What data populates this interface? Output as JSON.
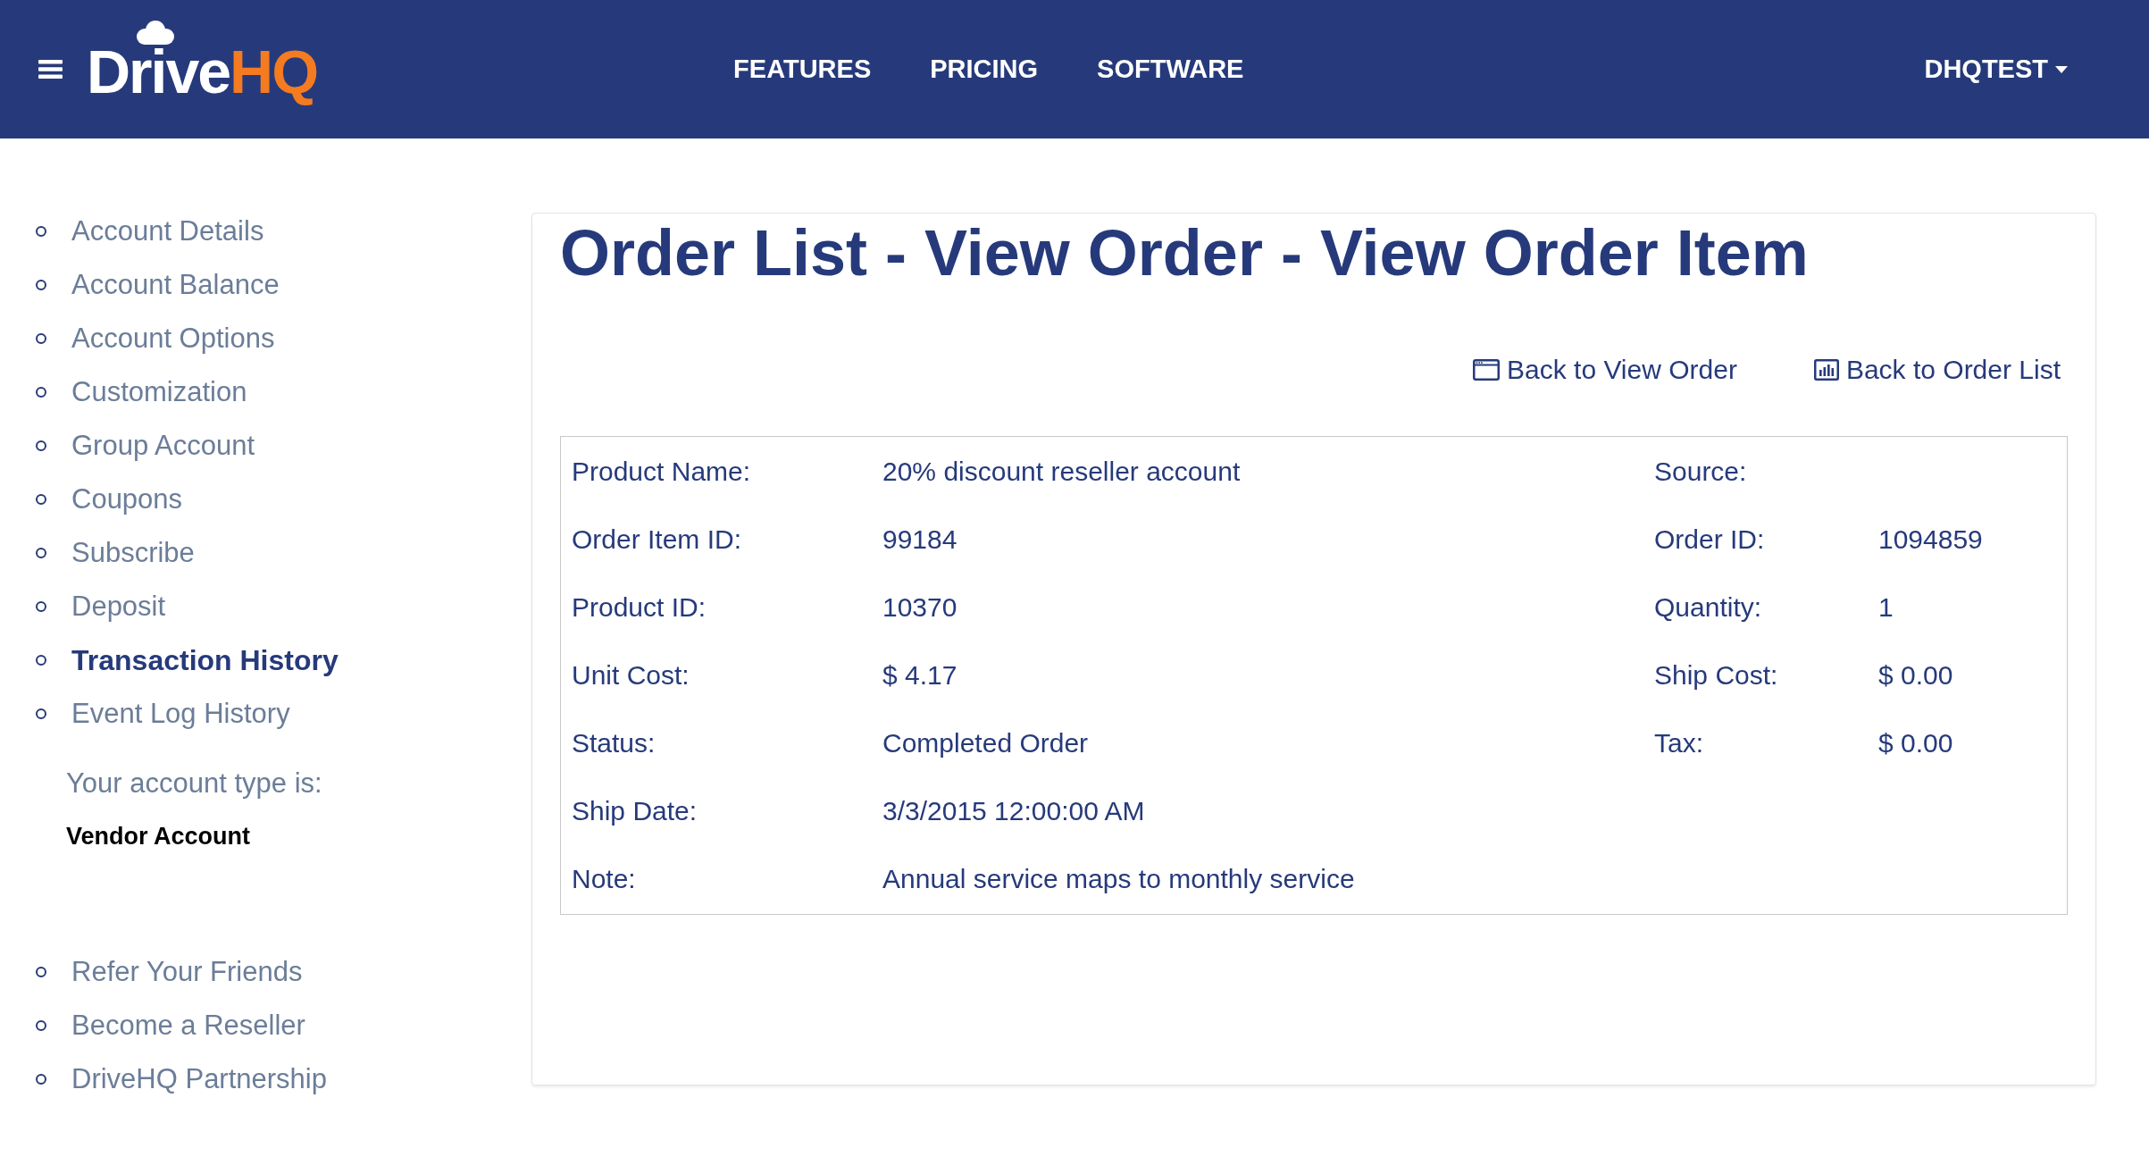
{
  "header": {
    "logo": {
      "text": "Drive",
      "accent": "HQ"
    },
    "nav": [
      {
        "label": "FEATURES"
      },
      {
        "label": "PRICING"
      },
      {
        "label": "SOFTWARE"
      }
    ],
    "user_menu": {
      "label": "DHQTEST"
    }
  },
  "sidebar": {
    "items": [
      {
        "label": "Account Details",
        "selected": false
      },
      {
        "label": "Account Balance",
        "selected": false
      },
      {
        "label": "Account Options",
        "selected": false
      },
      {
        "label": "Customization",
        "selected": false
      },
      {
        "label": "Group Account",
        "selected": false
      },
      {
        "label": "Coupons",
        "selected": false
      },
      {
        "label": "Subscribe",
        "selected": false
      },
      {
        "label": "Deposit",
        "selected": false
      },
      {
        "label": "Transaction History",
        "selected": true
      },
      {
        "label": "Event Log History",
        "selected": false
      }
    ],
    "account_type": {
      "label": "Your account type is:",
      "value": "Vendor Account"
    },
    "more_items": [
      {
        "label": "Refer Your Friends",
        "selected": false
      },
      {
        "label": "Become a Reseller",
        "selected": false
      },
      {
        "label": "DriveHQ Partnership",
        "selected": false
      }
    ]
  },
  "main": {
    "title": "Order List - View Order - View Order Item",
    "links": [
      {
        "label": "Back to View Order"
      },
      {
        "label": "Back to Order List"
      }
    ],
    "details": {
      "rows": [
        {
          "cells": [
            {
              "label": "Product Name:",
              "value": "20% discount reseller account"
            },
            {
              "label": "Source:"
            }
          ]
        },
        {
          "cells": [
            {
              "label": "Order Item ID:",
              "value": "99184"
            },
            {
              "label": "Order ID:",
              "value": "1094859"
            }
          ]
        },
        {
          "cells": [
            {
              "label": "Product ID:",
              "value": "10370"
            },
            {
              "label": "Quantity:",
              "value": "1"
            }
          ]
        },
        {
          "cells": [
            {
              "label": "Unit Cost:",
              "value": "$ 4.17"
            },
            {
              "label": "Ship Cost:",
              "value": "$ 0.00"
            }
          ]
        },
        {
          "cells": [
            {
              "label": "Status:",
              "value": "Completed Order"
            },
            {
              "label": "Tax:",
              "value": "$ 0.00"
            }
          ]
        },
        {
          "cells": [
            {
              "label": "Ship Date:",
              "value": "3/3/2015 12:00:00 AM"
            }
          ]
        },
        {
          "cells": [
            {
              "label": "Note:",
              "value": "Annual service maps to monthly service"
            }
          ]
        }
      ]
    }
  }
}
